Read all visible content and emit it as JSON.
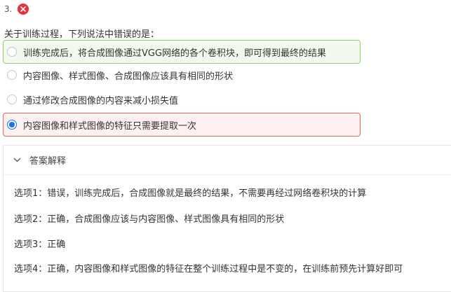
{
  "question": {
    "number": "3.",
    "status_icon": "close-icon",
    "stem": "关于训练过程，下列说法中错误的是："
  },
  "options": [
    {
      "text": "训练完成后，将合成图像通过VGG网络的各个卷积块，即可得到最终的结果",
      "state": "correct"
    },
    {
      "text": "内容图像、样式图像、合成图像应该具有相同的形状",
      "state": "none"
    },
    {
      "text": "通过修改合成图像的内容来减小损失值",
      "state": "none"
    },
    {
      "text": "内容图像和样式图像的特征只需要提取一次",
      "state": "selected-wrong"
    }
  ],
  "explanation": {
    "title": "答案解释",
    "lines": [
      "选项1：错误，训练完成后，合成图像就是最终的结果，不需要再经过网络卷积块的计算",
      "选项2：正确，合成图像应该与内容图像、样式图像具有相同的形状",
      "选项3：正确",
      "选项4：正确，内容图像和样式图像的特征在整个训练过程中是不变的，在训练前预先计算好即可"
    ]
  },
  "colors": {
    "correct_border": "#8ccf6e",
    "wrong_border": "#e8656b",
    "wrong_icon": "#e8313a",
    "radio_checked": "#1a73e8"
  }
}
